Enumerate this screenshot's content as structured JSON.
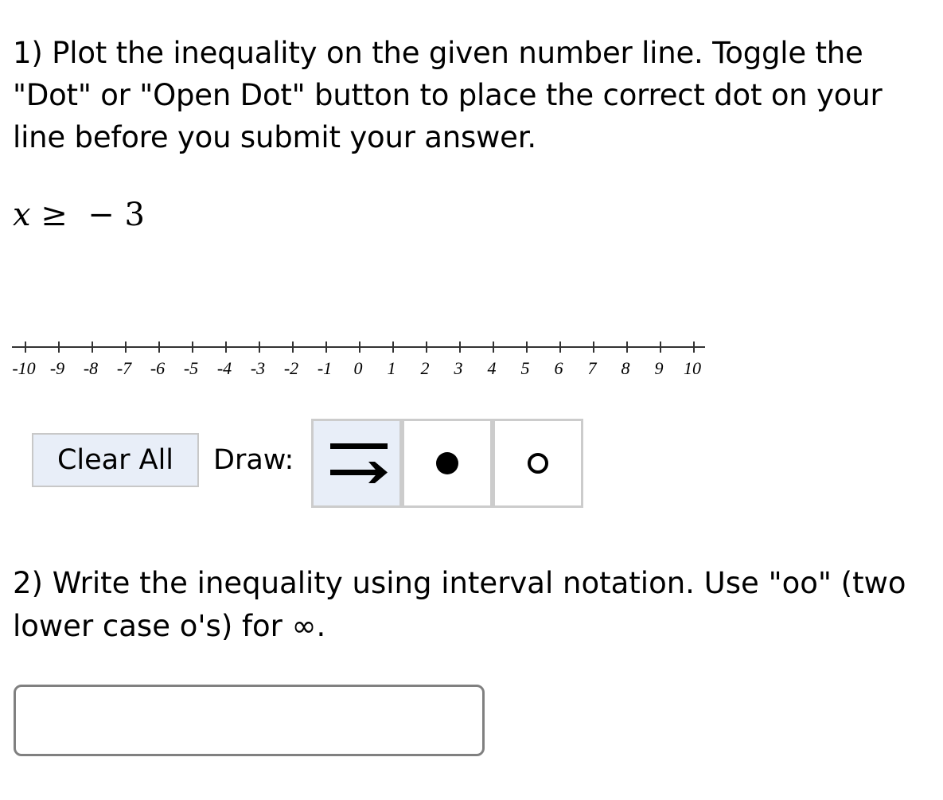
{
  "question1": {
    "text": "1) Plot the inequality on the given number line. Toggle the \"Dot\" or \"Open Dot\" button to place the correct dot on your line before you submit your answer.",
    "inequality": {
      "variable": "x",
      "operator": "≥",
      "rhs": "− 3"
    },
    "number_line": {
      "min": -10,
      "max": 10,
      "step": 1,
      "tick_labels": [
        "-10",
        "-9",
        "-8",
        "-7",
        "-6",
        "-5",
        "-4",
        "-3",
        "-2",
        "-1",
        "0",
        "1",
        "2",
        "3",
        "4",
        "5",
        "6",
        "7",
        "8",
        "9",
        "10"
      ]
    },
    "toolbar": {
      "clear_all_label": "Clear All",
      "draw_label": "Draw:",
      "tools": [
        {
          "name": "ray",
          "icon": "ray-arrow-icon",
          "active": true
        },
        {
          "name": "dot",
          "icon": "filled-dot-icon",
          "active": false
        },
        {
          "name": "open-dot",
          "icon": "open-dot-icon",
          "active": false
        }
      ]
    }
  },
  "question2": {
    "text": "2) Write the inequality using interval notation. Use \"oo\" (two lower case o's) for ∞.",
    "answer_value": "",
    "answer_placeholder": ""
  }
}
